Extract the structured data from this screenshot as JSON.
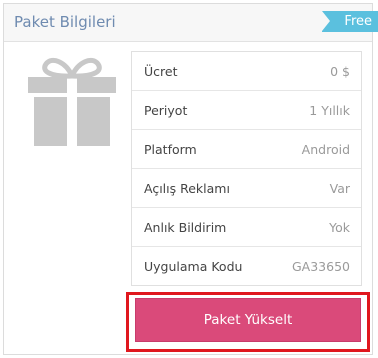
{
  "panel": {
    "title": "Paket Bilgileri",
    "badge": "Free"
  },
  "icon": "gift-icon",
  "details": [
    {
      "label": "Ücret",
      "value": "0 $"
    },
    {
      "label": "Periyot",
      "value": "1 Yıllık"
    },
    {
      "label": "Platform",
      "value": "Android"
    },
    {
      "label": "Açılış Reklamı",
      "value": "Var"
    },
    {
      "label": "Anlık Bildirim",
      "value": "Yok"
    },
    {
      "label": "Uygulama Kodu",
      "value": "GA33650"
    }
  ],
  "actions": {
    "upgrade_label": "Paket Yükselt"
  },
  "colors": {
    "title": "#6f8bb0",
    "badge": "#5bc0de",
    "button": "#da4a7a",
    "highlight_border": "#e0171e",
    "gift": "#c8c8c8"
  }
}
